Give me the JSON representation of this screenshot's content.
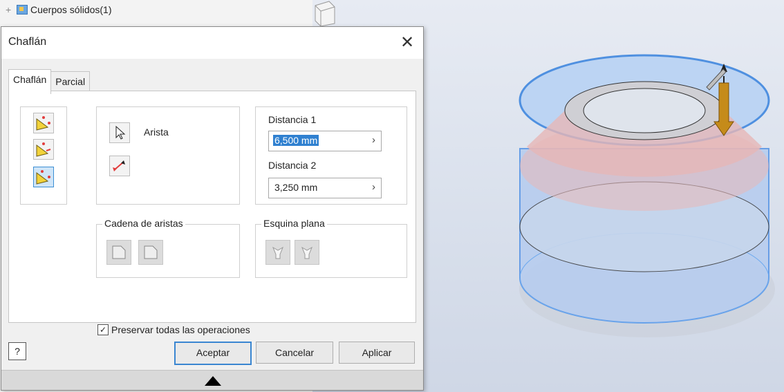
{
  "browser": {
    "tree_item": "Cuerpos sólidos(1)"
  },
  "dialog": {
    "title": "Chaflán",
    "tabs": [
      "Chaflán",
      "Parcial"
    ],
    "edge_label": "Arista",
    "distance1_label": "Distancia 1",
    "distance1_value": "6,500 mm",
    "distance2_label": "Distancia 2",
    "distance2_value": "3,250 mm",
    "edge_chain_label": "Cadena de aristas",
    "flat_corner_label": "Esquina plana",
    "preserve_label": "Preservar todas las operaciones",
    "preserve_checked": true,
    "help_label": "?",
    "ok_label": "Aceptar",
    "cancel_label": "Cancelar",
    "apply_label": "Aplicar"
  },
  "icons": [
    "close-icon",
    "chamfer-distance-icon",
    "chamfer-distance-angle-icon",
    "chamfer-two-distances-icon",
    "select-cursor-icon",
    "flip-icon",
    "collapse-arrow-icon"
  ],
  "colors": {
    "selection_blue": "#2f80d0",
    "part_blue": "#6aa8ef",
    "chamfer_face": "#e8b8b8"
  }
}
